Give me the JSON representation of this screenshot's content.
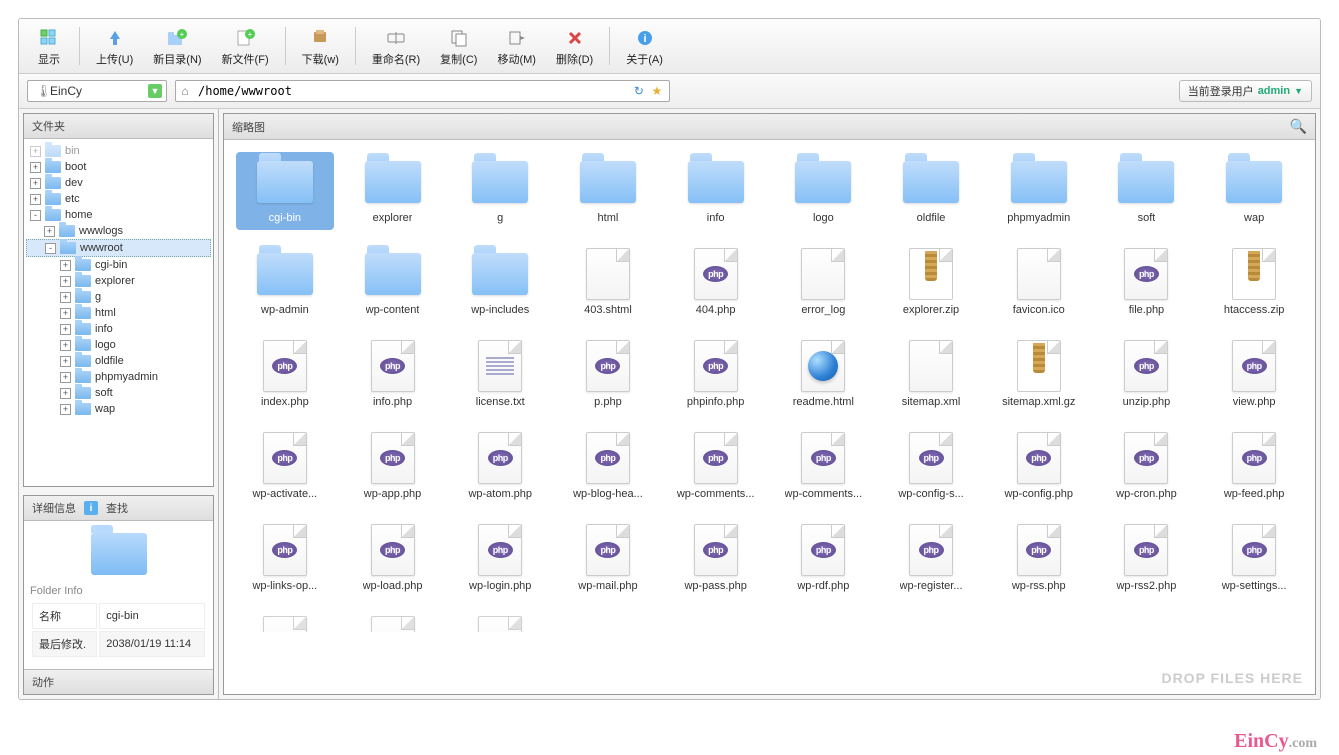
{
  "toolbar": {
    "show": "显示",
    "upload": "上传(U)",
    "newdir": "新目录(N)",
    "newfile": "新文件(F)",
    "download": "下载(w)",
    "rename": "重命名(R)",
    "copy": "复制(C)",
    "move": "移动(M)",
    "delete": "删除(D)",
    "about": "关于(A)"
  },
  "pathbar": {
    "profile": "EinCy",
    "path": "/home/wwwroot",
    "user_label": "当前登录用户",
    "user_name": "admin"
  },
  "tree": {
    "header": "文件夹",
    "nodes": [
      {
        "label": "bin",
        "depth": 0,
        "exp": "+",
        "sel": false,
        "faded": true
      },
      {
        "label": "boot",
        "depth": 0,
        "exp": "+",
        "sel": false
      },
      {
        "label": "dev",
        "depth": 0,
        "exp": "+",
        "sel": false
      },
      {
        "label": "etc",
        "depth": 0,
        "exp": "+",
        "sel": false
      },
      {
        "label": "home",
        "depth": 0,
        "exp": "-",
        "sel": false
      },
      {
        "label": "wwwlogs",
        "depth": 1,
        "exp": "+",
        "sel": false
      },
      {
        "label": "wwwroot",
        "depth": 1,
        "exp": "-",
        "sel": true
      },
      {
        "label": "cgi-bin",
        "depth": 2,
        "exp": "+",
        "sel": false
      },
      {
        "label": "explorer",
        "depth": 2,
        "exp": "+",
        "sel": false
      },
      {
        "label": "g",
        "depth": 2,
        "exp": "+",
        "sel": false
      },
      {
        "label": "html",
        "depth": 2,
        "exp": "+",
        "sel": false
      },
      {
        "label": "info",
        "depth": 2,
        "exp": "+",
        "sel": false
      },
      {
        "label": "logo",
        "depth": 2,
        "exp": "+",
        "sel": false
      },
      {
        "label": "oldfile",
        "depth": 2,
        "exp": "+",
        "sel": false
      },
      {
        "label": "phpmyadmin",
        "depth": 2,
        "exp": "+",
        "sel": false
      },
      {
        "label": "soft",
        "depth": 2,
        "exp": "+",
        "sel": false
      },
      {
        "label": "wap",
        "depth": 2,
        "exp": "+",
        "sel": false
      }
    ]
  },
  "detail": {
    "header": "详细信息",
    "tab_find": "查找",
    "title": "Folder Info",
    "name_label": "名称",
    "name_value": "cgi-bin",
    "mod_label": "最后修改.",
    "mod_value": "2038/01/19 11:14",
    "actions": "动作"
  },
  "grid": {
    "header": "缩略图",
    "drop_hint": "DROP FILES HERE",
    "items": [
      {
        "name": "cgi-bin",
        "type": "folder",
        "sel": true
      },
      {
        "name": "explorer",
        "type": "folder"
      },
      {
        "name": "g",
        "type": "folder"
      },
      {
        "name": "html",
        "type": "folder"
      },
      {
        "name": "info",
        "type": "folder"
      },
      {
        "name": "logo",
        "type": "folder"
      },
      {
        "name": "oldfile",
        "type": "folder"
      },
      {
        "name": "phpmyadmin",
        "type": "folder"
      },
      {
        "name": "soft",
        "type": "folder"
      },
      {
        "name": "wap",
        "type": "folder"
      },
      {
        "name": "wp-admin",
        "type": "folder"
      },
      {
        "name": "wp-content",
        "type": "folder"
      },
      {
        "name": "wp-includes",
        "type": "folder"
      },
      {
        "name": "403.shtml",
        "type": "file"
      },
      {
        "name": "404.php",
        "type": "php"
      },
      {
        "name": "error_log",
        "type": "file"
      },
      {
        "name": "explorer.zip",
        "type": "zip"
      },
      {
        "name": "favicon.ico",
        "type": "file"
      },
      {
        "name": "file.php",
        "type": "php"
      },
      {
        "name": "htaccess.zip",
        "type": "zip"
      },
      {
        "name": "index.php",
        "type": "php"
      },
      {
        "name": "info.php",
        "type": "php"
      },
      {
        "name": "license.txt",
        "type": "txt"
      },
      {
        "name": "p.php",
        "type": "php"
      },
      {
        "name": "phpinfo.php",
        "type": "php"
      },
      {
        "name": "readme.html",
        "type": "html"
      },
      {
        "name": "sitemap.xml",
        "type": "file"
      },
      {
        "name": "sitemap.xml.gz",
        "type": "zip"
      },
      {
        "name": "unzip.php",
        "type": "php"
      },
      {
        "name": "view.php",
        "type": "php"
      },
      {
        "name": "wp-activate...",
        "type": "php"
      },
      {
        "name": "wp-app.php",
        "type": "php"
      },
      {
        "name": "wp-atom.php",
        "type": "php"
      },
      {
        "name": "wp-blog-hea...",
        "type": "php"
      },
      {
        "name": "wp-comments...",
        "type": "php"
      },
      {
        "name": "wp-comments...",
        "type": "php"
      },
      {
        "name": "wp-config-s...",
        "type": "php"
      },
      {
        "name": "wp-config.php",
        "type": "php"
      },
      {
        "name": "wp-cron.php",
        "type": "php"
      },
      {
        "name": "wp-feed.php",
        "type": "php"
      },
      {
        "name": "wp-links-op...",
        "type": "php"
      },
      {
        "name": "wp-load.php",
        "type": "php"
      },
      {
        "name": "wp-login.php",
        "type": "php"
      },
      {
        "name": "wp-mail.php",
        "type": "php"
      },
      {
        "name": "wp-pass.php",
        "type": "php"
      },
      {
        "name": "wp-rdf.php",
        "type": "php"
      },
      {
        "name": "wp-register...",
        "type": "php"
      },
      {
        "name": "wp-rss.php",
        "type": "php"
      },
      {
        "name": "wp-rss2.php",
        "type": "php"
      },
      {
        "name": "wp-settings...",
        "type": "php"
      },
      {
        "name": "",
        "type": "php",
        "partial": true
      },
      {
        "name": "",
        "type": "php",
        "partial": true
      },
      {
        "name": "",
        "type": "php",
        "partial": true
      }
    ]
  },
  "watermark": {
    "brand": "EinCy",
    "suffix": ".com"
  }
}
